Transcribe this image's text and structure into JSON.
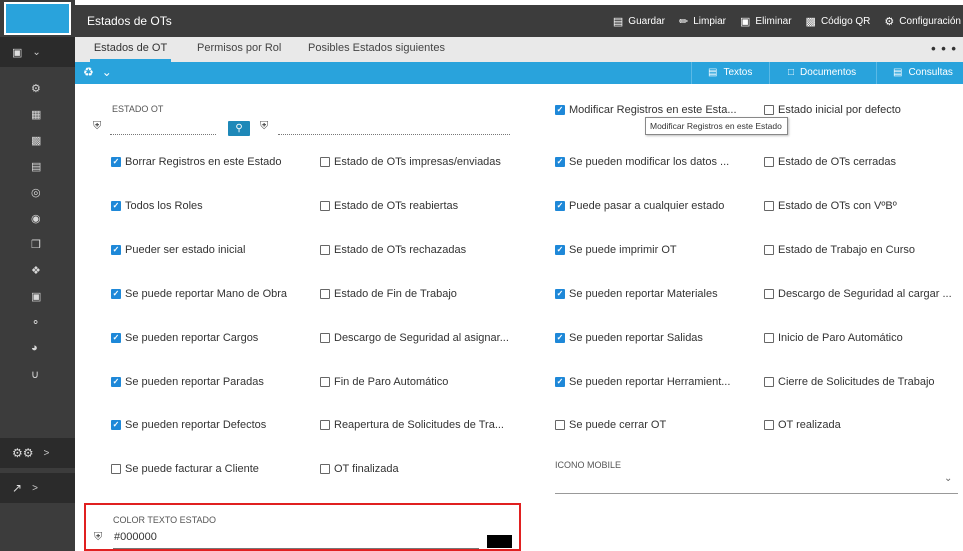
{
  "header": {
    "title": "Estados de OTs",
    "toolbar": [
      {
        "label": "Guardar",
        "icon": "save-icon"
      },
      {
        "label": "Limpiar",
        "icon": "eraser-icon"
      },
      {
        "label": "Eliminar",
        "icon": "trash-icon"
      },
      {
        "label": "Código QR",
        "icon": "qr-icon"
      },
      {
        "label": "Configuración",
        "icon": "gear-icon"
      }
    ]
  },
  "tabs": [
    {
      "label": "Estados de OT",
      "active": true
    },
    {
      "label": "Permisos por Rol",
      "active": false
    },
    {
      "label": "Posibles Estados siguientes",
      "active": false
    }
  ],
  "more_label": "• • •",
  "action_bar": {
    "buttons": [
      {
        "label": "Textos",
        "icon": "text-file-icon"
      },
      {
        "label": "Documentos",
        "icon": "document-icon"
      },
      {
        "label": "Consultas",
        "icon": "database-icon"
      }
    ]
  },
  "sidebar": {
    "icons": [
      "gear-icon",
      "dashboard-icon",
      "calendar-icon",
      "clipboard-icon",
      "globe-icon",
      "target-icon",
      "cart-icon",
      "tools-icon",
      "box-icon",
      "key-icon",
      "gauge-icon",
      "magnet-icon"
    ],
    "groups": [
      {
        "icon": "settings-icon",
        "chevron": ">"
      },
      {
        "icon": "chart-icon",
        "chevron": ">"
      }
    ]
  },
  "form": {
    "estado_ot_label": "ESTADO OT",
    "estado_ot_value": "",
    "icono_mobile_label": "ICONO MOBILE",
    "color_texto_label": "COLOR TEXTO ESTADO",
    "color_texto_value": "#000000",
    "color_swatch": "#000000",
    "tooltip": "Modificar Registros en este Estado"
  },
  "checkboxes": {
    "col1": [
      {
        "label": "Borrar Registros en este Estado",
        "checked": true
      },
      {
        "label": "Todos los Roles",
        "checked": true
      },
      {
        "label": "Pueder ser estado inicial",
        "checked": true
      },
      {
        "label": "Se puede reportar Mano de Obra",
        "checked": true
      },
      {
        "label": "Se pueden reportar Cargos",
        "checked": true
      },
      {
        "label": "Se pueden reportar Paradas",
        "checked": true
      },
      {
        "label": "Se pueden reportar Defectos",
        "checked": true
      },
      {
        "label": "Se puede facturar a Cliente",
        "checked": false
      }
    ],
    "col2": [
      {
        "label": "Estado de OTs impresas/enviadas",
        "checked": false
      },
      {
        "label": "Estado de OTs reabiertas",
        "checked": false
      },
      {
        "label": "Estado de OTs rechazadas",
        "checked": false
      },
      {
        "label": "Estado de Fin de Trabajo",
        "checked": false
      },
      {
        "label": "Descargo de Seguridad al asignar...",
        "checked": false
      },
      {
        "label": "Fin de Paro Automático",
        "checked": false
      },
      {
        "label": "Reapertura de Solicitudes de Tra...",
        "checked": false
      },
      {
        "label": "OT finalizada",
        "checked": false
      }
    ],
    "col3": [
      {
        "label": "Modificar Registros en este Esta...",
        "checked": true
      },
      {
        "label": "Se pueden modificar los datos ...",
        "checked": true
      },
      {
        "label": "Puede pasar a cualquier estado",
        "checked": true
      },
      {
        "label": "Se puede imprimir OT",
        "checked": true
      },
      {
        "label": "Se pueden reportar Materiales",
        "checked": true
      },
      {
        "label": "Se pueden reportar Salidas",
        "checked": true
      },
      {
        "label": "Se pueden reportar Herramient...",
        "checked": true
      },
      {
        "label": "Se puede cerrar OT",
        "checked": false
      }
    ],
    "col4": [
      {
        "label": "Estado inicial por defecto",
        "checked": false
      },
      {
        "label": "Estado de OTs cerradas",
        "checked": false
      },
      {
        "label": "Estado de OTs con VºBº",
        "checked": false
      },
      {
        "label": "Estado de Trabajo en Curso",
        "checked": false
      },
      {
        "label": "Descargo de Seguridad al cargar ...",
        "checked": false
      },
      {
        "label": "Inicio de Paro Automático",
        "checked": false
      },
      {
        "label": "Cierre de Solicitudes de Trabajo",
        "checked": false
      },
      {
        "label": "OT realizada",
        "checked": false
      }
    ]
  },
  "colors": {
    "accent": "#29a3dc",
    "checkbox_on": "#1e88d8",
    "sidebar_bg": "#3c3c3c",
    "highlight_border": "#e02020"
  }
}
